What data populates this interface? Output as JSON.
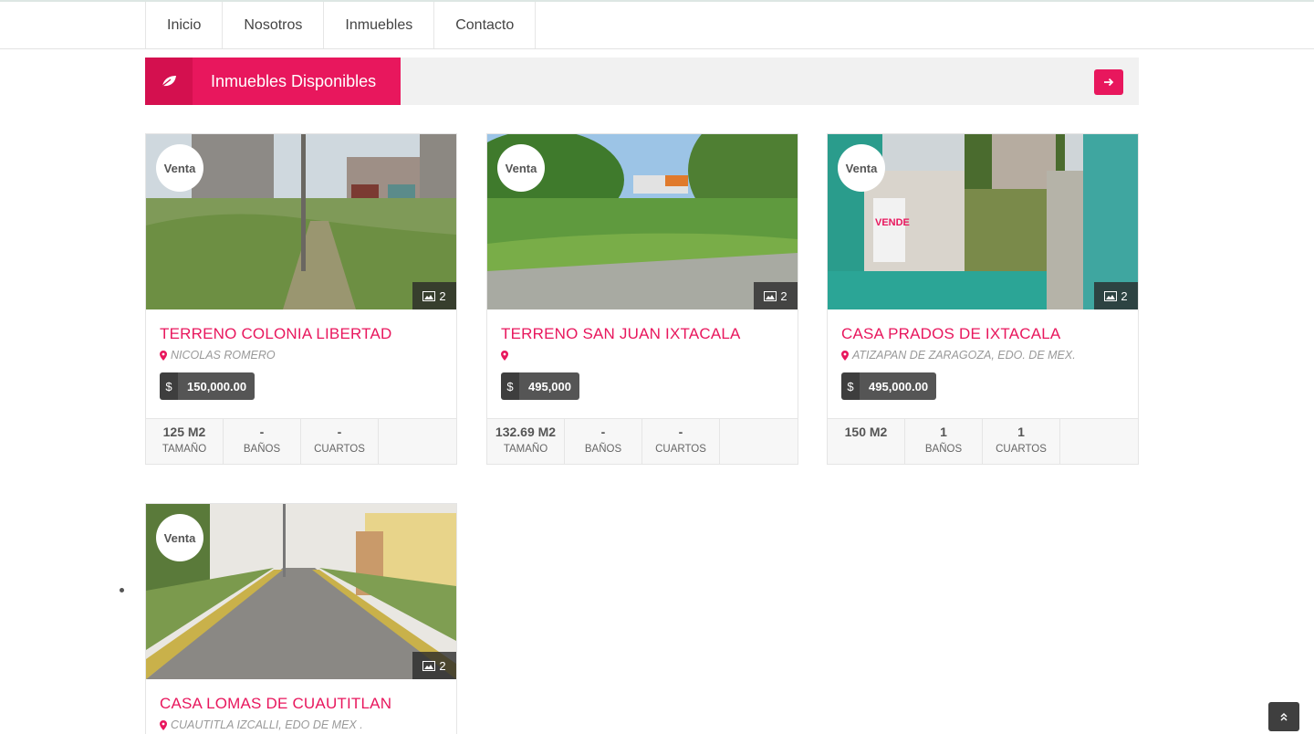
{
  "nav": {
    "items": [
      {
        "label": "Inicio"
      },
      {
        "label": "Nosotros"
      },
      {
        "label": "Inmuebles"
      },
      {
        "label": "Contacto"
      }
    ]
  },
  "section": {
    "title": "Inmuebles Disponibles",
    "icon": "leaf-icon",
    "next_icon": "arrow-right-icon"
  },
  "colors": {
    "accent": "#e8175d",
    "dark": "#3f3f3f"
  },
  "listings": [
    {
      "badge": "Venta",
      "photos": "2",
      "title": "TERRENO COLONIA LIBERTAD",
      "location": "NICOLAS ROMERO",
      "currency": "$",
      "price": "150,000.00",
      "stats": [
        {
          "value": "125 M2",
          "label": "TAMAÑO"
        },
        {
          "value": "-",
          "label": "BAÑOS"
        },
        {
          "value": "-",
          "label": "CUARTOS"
        }
      ]
    },
    {
      "badge": "Venta",
      "photos": "2",
      "title": "TERRENO SAN JUAN IXTACALA",
      "location": "",
      "currency": "$",
      "price": "495,000",
      "stats": [
        {
          "value": "132.69 M2",
          "label": "TAMAÑO"
        },
        {
          "value": "-",
          "label": "BAÑOS"
        },
        {
          "value": "-",
          "label": "CUARTOS"
        }
      ]
    },
    {
      "badge": "Venta",
      "photos": "2",
      "title": "CASA PRADOS DE IXTACALA",
      "location": "ATIZAPAN DE ZARAGOZA, EDO. DE MEX.",
      "currency": "$",
      "price": "495,000.00",
      "stats": [
        {
          "value": "150 M2",
          "label": ""
        },
        {
          "value": "1",
          "label": "BAÑOS"
        },
        {
          "value": "1",
          "label": "CUARTOS"
        }
      ]
    },
    {
      "badge": "Venta",
      "photos": "2",
      "title": "CASA LOMAS DE CUAUTITLAN",
      "location": "CUAUTITLA IZCALLI, EDO DE MEX ."
    }
  ]
}
